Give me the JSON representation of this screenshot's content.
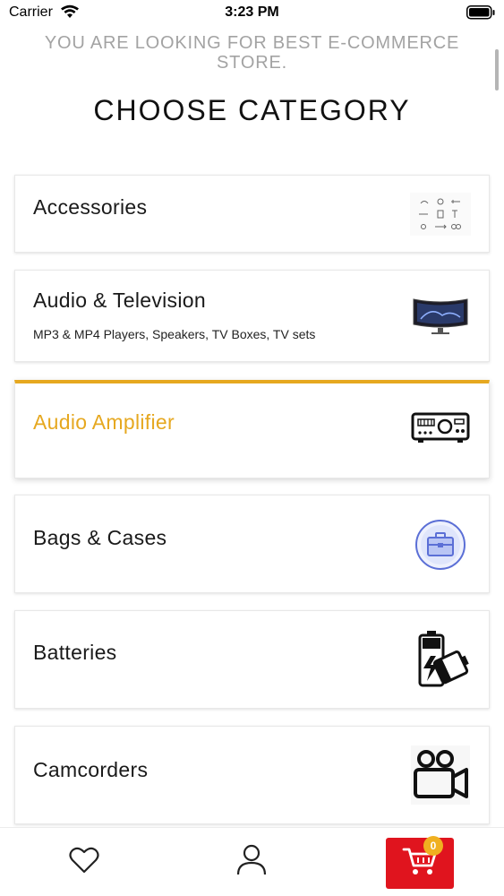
{
  "status_bar": {
    "carrier": "Carrier",
    "time": "3:23 PM"
  },
  "header": {
    "subheading": "YOU ARE LOOKING FOR BEST E-COMMERCE STORE.",
    "title": "CHOOSE CATEGORY"
  },
  "categories": [
    {
      "title": "Accessories",
      "subtitle": "",
      "icon": "accessories-thumbnail-icon",
      "active": false
    },
    {
      "title": "Audio & Television",
      "subtitle": "MP3 & MP4 Players, Speakers, TV Boxes, TV sets",
      "icon": "curved-monitor-thumbnail-icon",
      "active": false
    },
    {
      "title": "Audio Amplifier",
      "subtitle": "",
      "icon": "amplifier-thumbnail-icon",
      "active": true
    },
    {
      "title": "Bags & Cases",
      "subtitle": "",
      "icon": "briefcase-thumbnail-icon",
      "active": false
    },
    {
      "title": "Batteries",
      "subtitle": "",
      "icon": "battery-thumbnail-icon",
      "active": false
    },
    {
      "title": "Camcorders",
      "subtitle": "",
      "icon": "camcorder-thumbnail-icon",
      "active": false
    }
  ],
  "tab_bar": {
    "items": [
      {
        "name": "wishlist",
        "icon": "heart-icon"
      },
      {
        "name": "account",
        "icon": "user-icon"
      },
      {
        "name": "cart",
        "icon": "cart-icon"
      }
    ],
    "cart_count": "0"
  },
  "colors": {
    "accent": "#e6a820",
    "cart_background": "#e0141e",
    "subheading": "#a3a3a3"
  }
}
